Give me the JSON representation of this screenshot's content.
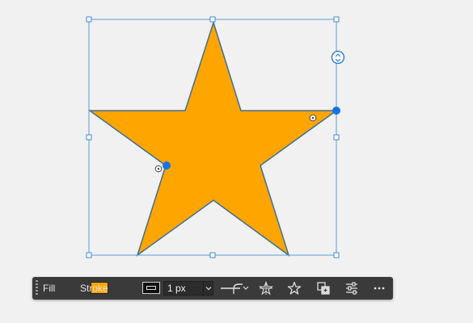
{
  "colors": {
    "background": "#f1f1f1",
    "star_fill": "#ffa500",
    "star_stroke": "#3d6f96",
    "selection": "#3b8bd8",
    "handle_fill": "#ffffff",
    "anchor": "#1473e6",
    "toolbar_bg": "#3a3a3a",
    "icon": "#dddddd"
  },
  "toolbar": {
    "fill_label": "Fill",
    "fill_color": "#ffa500",
    "stroke_label": "Stroke",
    "stroke_color": "#111111",
    "stroke_width": "1 px",
    "line_style": "solid"
  },
  "icons": {
    "toolbar_grip": "grip-icon",
    "stroke_width_dropdown": "chevron-down-icon",
    "line_style_dropdown": "chevron-down-icon",
    "corner_radius": "corner-radius-icon",
    "star_points": "star-settings-icon",
    "star_shape": "star-icon",
    "arrange": "arrange-icon",
    "properties": "sliders-icon",
    "more": "more-icon",
    "rotate_handle": "rotate-icon"
  }
}
